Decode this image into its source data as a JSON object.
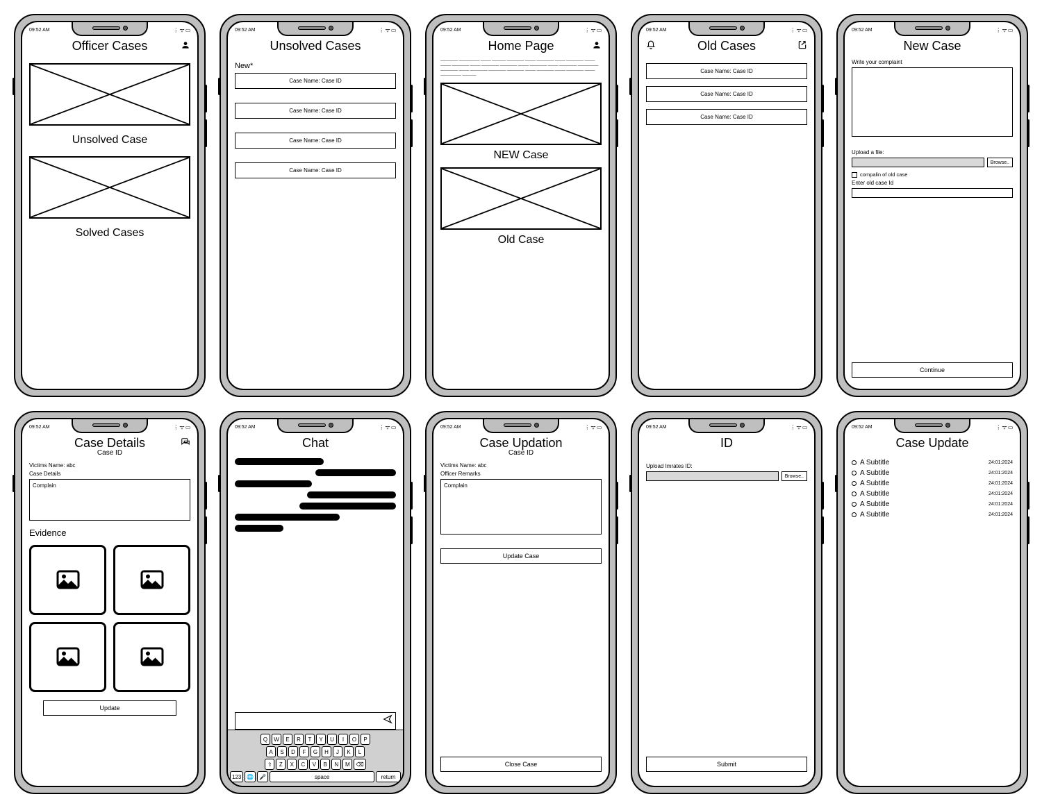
{
  "status": {
    "time": "09:52 AM",
    "indicators": "⋮ ᯤ ▭"
  },
  "screens": {
    "officer": {
      "title": "Officer Cases",
      "labels": {
        "unsolved": "Unsolved Case",
        "solved": "Solved Cases"
      }
    },
    "unsolved": {
      "title": "Unsolved Cases",
      "section": "New*",
      "item": "Case Name: Case ID"
    },
    "home": {
      "title": "Home Page",
      "filler": "————— —————— ——— ———— ————— ——— ————— ——— ————— ——— ——— ————— ——— ————— ————— ——— ————— ——— ————— —————— ————— ——— ————— ————— ————— ——— ————— ——— ————— ——— —————— ————",
      "new_label": "NEW Case",
      "old_label": "Old Case"
    },
    "old": {
      "title": "Old Cases",
      "item": "Case Name:  Case ID"
    },
    "newcase": {
      "title": "New Case",
      "complaint_label": "Write your complaint",
      "upload_label": "Upload a file:",
      "browse": "Browse..",
      "checkbox_label": "compalin of old case",
      "oldid_label": "Enter old case Id",
      "continue": "Continue"
    },
    "details": {
      "title": "Case Details",
      "subtitle": "Case ID",
      "victim": "Victims Name: abc",
      "details_label": "Case Details",
      "complain": "Complain",
      "evidence": "Evidence",
      "update": "Update"
    },
    "chat": {
      "title": "Chat",
      "space": "space",
      "return": "return",
      "num": "123"
    },
    "updation": {
      "title": "Case Updation",
      "subtitle": "Case ID",
      "victim": "Victims Name: abc",
      "remarks_label": "Officer Remarks",
      "complain": "Complain",
      "update_btn": "Update Case",
      "close_btn": "Close Case"
    },
    "id": {
      "title": "ID",
      "upload_label": "Upload Imrates ID:",
      "browse": "Browse..",
      "submit": "Submit"
    },
    "caseupdate": {
      "title": "Case Update",
      "items": [
        {
          "label": "A Subtitle",
          "date": "24:01:2024"
        },
        {
          "label": "A Subtitle",
          "date": "24:01:2024"
        },
        {
          "label": "A Subtitle",
          "date": "24:01:2024"
        },
        {
          "label": "A Subtitle",
          "date": "24:01:2024"
        },
        {
          "label": "A Subtitle",
          "date": "24:01:2024"
        },
        {
          "label": "A Subtitle",
          "date": "24:01:2024"
        }
      ]
    },
    "keyboard": {
      "r1": [
        "Q",
        "W",
        "E",
        "R",
        "T",
        "Y",
        "U",
        "I",
        "O",
        "P"
      ],
      "r2": [
        "A",
        "S",
        "D",
        "F",
        "G",
        "H",
        "J",
        "K",
        "L"
      ],
      "r3": [
        "⇧",
        "Z",
        "X",
        "C",
        "V",
        "B",
        "N",
        "M",
        "⌫"
      ]
    }
  }
}
